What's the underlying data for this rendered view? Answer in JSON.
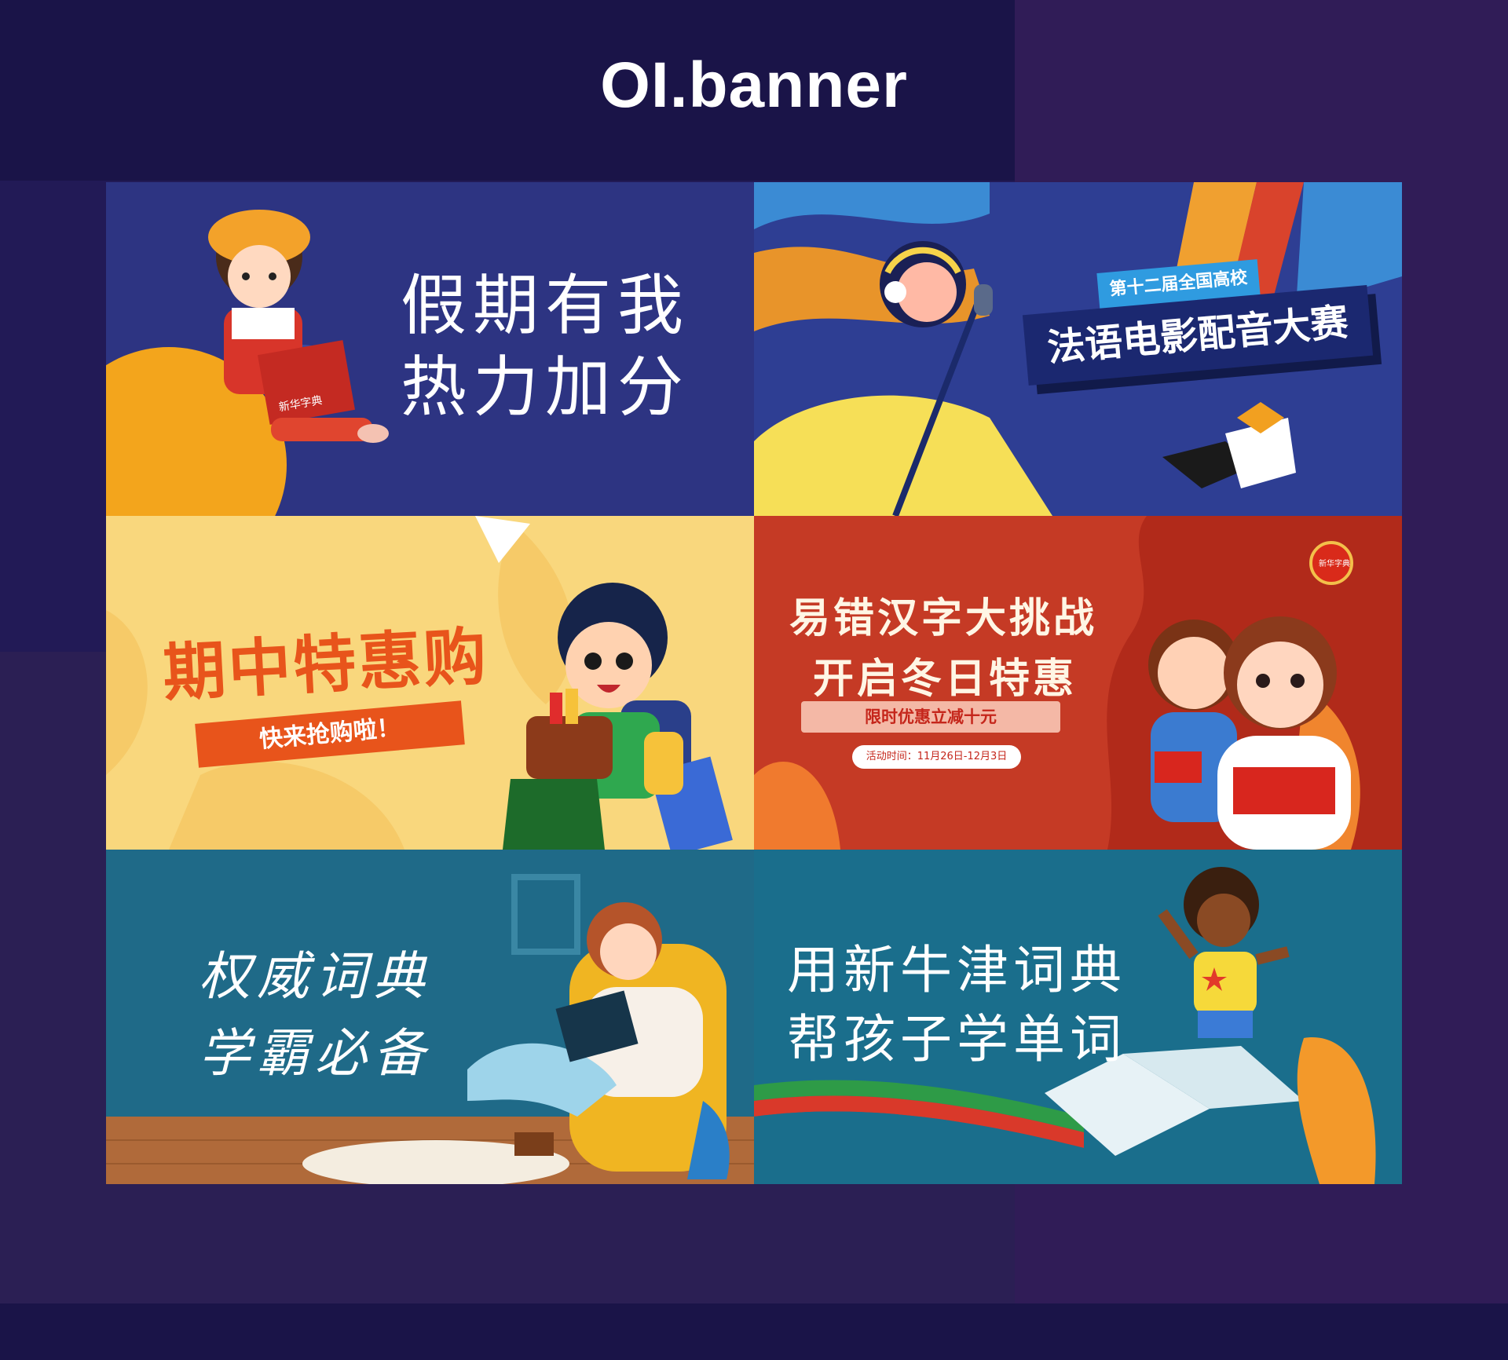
{
  "page": {
    "title": "OI.banner",
    "background_color": "#1a1448"
  },
  "banners": [
    {
      "id": "holiday",
      "line1": "假期有我",
      "line2": "热力加分",
      "book_title": "新华字典",
      "bg_color": "#2d3482"
    },
    {
      "id": "french-dubbing",
      "subtitle": "第十二届全国高校",
      "title": "法语电影配音大赛",
      "bg_color": "#2e3e93"
    },
    {
      "id": "midterm-sale",
      "title": "期中特惠购",
      "ribbon": "快来抢购啦！",
      "bg_color": "#f9d77d"
    },
    {
      "id": "winter-sale",
      "line1": "易错汉字大挑战",
      "line2": "开启冬日特惠",
      "ribbon": "限时优惠立减十元",
      "date_badge": "活动时间：11月26日-12月3日",
      "seal_text": "新华字典",
      "bg_color": "#c53a25"
    },
    {
      "id": "authoritative-dictionary",
      "line1": "权威词典",
      "line2": "学霸必备",
      "bg_color": "#1f6a88"
    },
    {
      "id": "new-oxford",
      "line1": "用新牛津词典",
      "line2": "帮孩子学单词",
      "bg_color": "#1a6e8c"
    }
  ]
}
